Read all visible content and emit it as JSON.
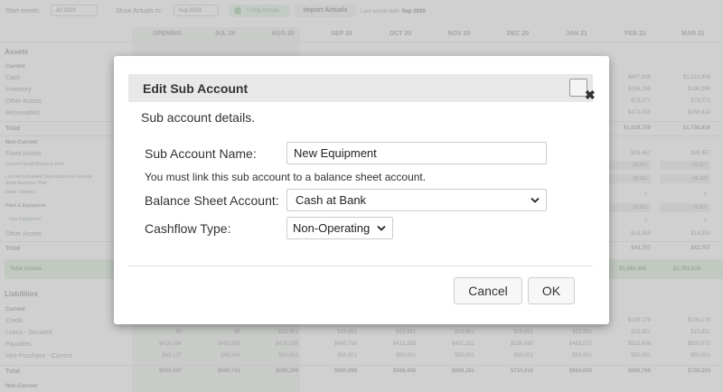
{
  "toolbar": {
    "start_month_label": "Start month:",
    "start_month_value": "Jul 2029",
    "show_actuals_label": "Show Actuals to:",
    "show_actuals_value": "Aug 2029",
    "using_actuals_label": "Using Actuals",
    "import_actuals_label": "Import Actuals",
    "last_actual_label": "Last actual date:",
    "last_actual_value": "Sep 2020"
  },
  "columns": [
    "OPENING",
    "JUL 20",
    "AUG 20",
    "SEP 20",
    "OCT 20",
    "NOV 20",
    "DEC 20",
    "JAN 21",
    "FEB 21",
    "MAR 21"
  ],
  "sheet": {
    "assets_title": "Assets",
    "current_label": "Current",
    "cash": "Cash",
    "inventory": "Inventory",
    "other_assets": "Other Assets",
    "receivables": "Receivables",
    "total": "Total",
    "non_current_label": "Non-Current",
    "fixed_assets": "Fixed Assets",
    "general_pool": "General Small Business Pool",
    "less_accum_1": "Less Accumulated Depreciation on General",
    "less_accum_2": "Small Business Pool",
    "motor_vehicles": "Motor Vehicles",
    "plant_equipment": "Plant & Equipment",
    "new_equipment": "New Equipment",
    "other_assets_nc": "Other Assets",
    "total_nc": "Total",
    "total_assets": "Total Assets",
    "liabilities_title": "Liabilities",
    "liab_current_label": "Current",
    "credit": "Credit",
    "loans_secured": "Loans - Secured",
    "payables": "Payables",
    "hire_purchase": "Hire Purchase - Current",
    "liab_total": "Total",
    "liab_non_current": "Non-Current"
  },
  "right_values": {
    "cash": [
      "$897,939",
      "$1,010,908"
    ],
    "inventory": [
      "$196,266",
      "$196,266"
    ],
    "other_assets": [
      "$73,071",
      "$73,071"
    ],
    "receivables": [
      "$472,433",
      "$458,614"
    ],
    "total": [
      "$1,639,729",
      "$1,738,859"
    ],
    "fixed_assets": [
      "$29,457",
      "$28,457"
    ],
    "general_pool": [
      "62,617",
      "62,617"
    ],
    "less_accum": [
      "-58,160",
      "-58,160"
    ],
    "motor_vehicles": [
      "0",
      "0"
    ],
    "plant_equipment": [
      "25,000",
      "25,000"
    ],
    "new_equipment": [
      "0",
      "0"
    ],
    "other_assets_nc": [
      "$14,300",
      "$14,300"
    ],
    "total_nc": [
      "$43,757",
      "$42,757"
    ],
    "total_assets": [
      "$1,683,486",
      "$1,781,616"
    ]
  },
  "liab_rows": {
    "loans": [
      "$0",
      "$0",
      "$15,951",
      "$15,951",
      "$15,951",
      "$15,951",
      "$15,951",
      "$15,951",
      "$15,931",
      "$15,931"
    ],
    "payables": [
      "$416,264",
      "$451,698",
      "$420,159",
      "$485,768",
      "$413,358",
      "$491,251",
      "$535,680",
      "$488,872",
      "$515,636",
      "$503,073"
    ],
    "hire": [
      "$49,127",
      "$49,564",
      "$50,001",
      "$50,001",
      "$50,001",
      "$50,001",
      "$50,001",
      "$50,001",
      "$50,001",
      "$50,001"
    ],
    "total": [
      "$554,357",
      "$606,741",
      "$595,289",
      "$660,898",
      "$388,498",
      "$666,381",
      "$710,810",
      "$664,002",
      "$690,766",
      "$738,203"
    ],
    "credit": [
      "$109,178",
      "$109,178"
    ]
  },
  "dialog": {
    "title": "Edit Sub Account",
    "close_symbol": "✖",
    "details_label": "Sub account details.",
    "name_label": "Sub Account Name:",
    "name_value": "New Equipment",
    "link_note": "You must link this sub account to a balance sheet account.",
    "bs_account_label": "Balance Sheet Account:",
    "bs_account_value": "Cash at Bank",
    "cashflow_label": "Cashflow Type:",
    "cashflow_value": "Non-Operating",
    "cancel_label": "Cancel",
    "ok_label": "OK"
  },
  "colors": {
    "accent_green": "#8fc08f",
    "overlay": "#787878",
    "dialog_header": "#e8e8e8"
  }
}
